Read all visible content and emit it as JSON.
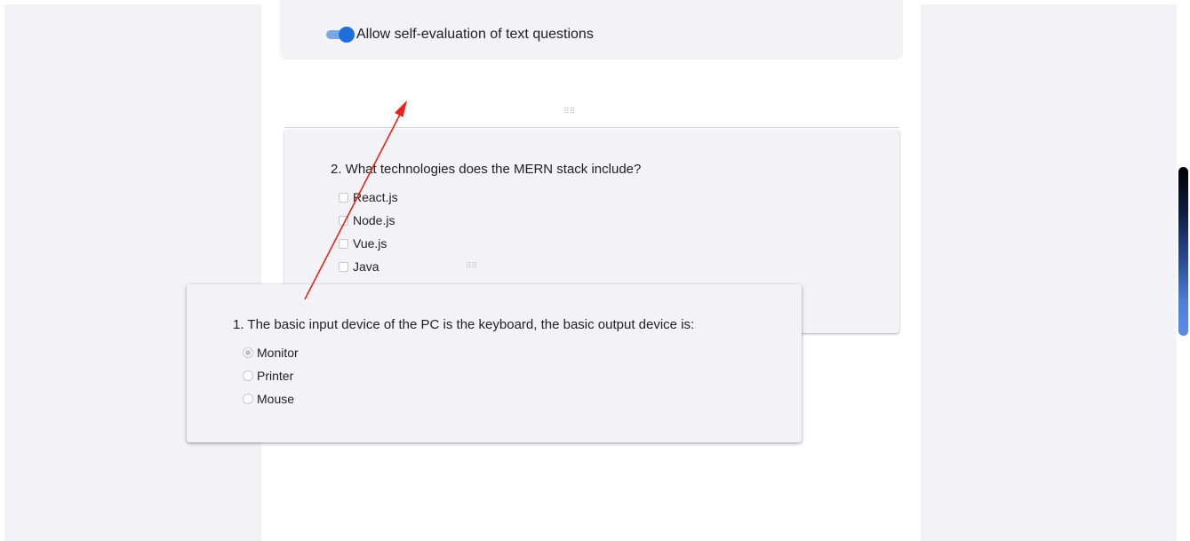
{
  "settings": {
    "self_eval_label": "Allow self-evaluation of text questions",
    "self_eval_enabled": true,
    "toggle_color": "#1e6fd9"
  },
  "question2": {
    "title": "2. What technologies does the MERN stack include?",
    "options": [
      {
        "label": "React.js",
        "checked": false
      },
      {
        "label": "Node.js",
        "checked": false
      },
      {
        "label": "Vue.js",
        "checked": false
      },
      {
        "label": "Java",
        "checked": false
      }
    ]
  },
  "question1": {
    "title": "1. The basic input device of the PC is the keyboard, the basic output device is:",
    "options": [
      {
        "label": "Monitor",
        "selected": true
      },
      {
        "label": "Printer",
        "selected": false
      },
      {
        "label": "Mouse",
        "selected": false
      }
    ]
  },
  "icons": {
    "drag_handle": "drag-handle-icon",
    "annotation_arrow": "red-arrow"
  },
  "colors": {
    "panel_bg": "#f3f3f7",
    "arrow": "#e8231c"
  }
}
